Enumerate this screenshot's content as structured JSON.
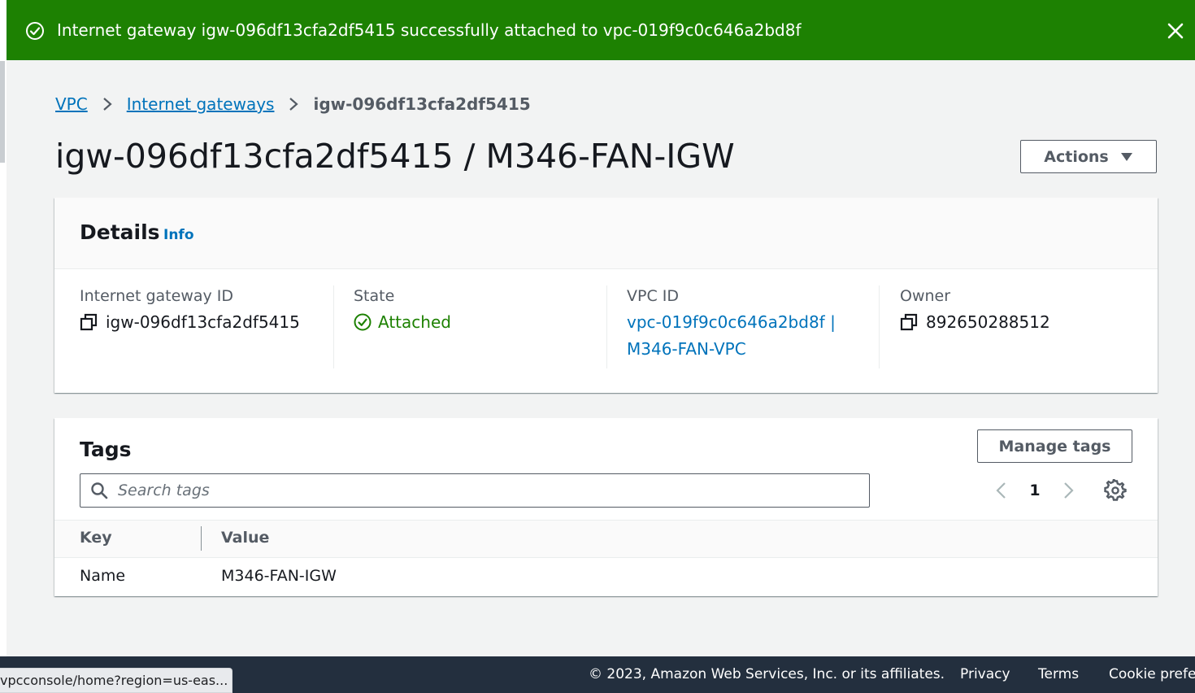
{
  "flash": {
    "message": "Internet gateway igw-096df13cfa2df5415 successfully attached to vpc-019f9c0c646a2bd8f",
    "color": "#1d8102"
  },
  "breadcrumb": {
    "items": [
      "VPC",
      "Internet gateways"
    ],
    "current": "igw-096df13cfa2df5415"
  },
  "page": {
    "title": "igw-096df13cfa2df5415 / M346-FAN-IGW",
    "actions_label": "Actions"
  },
  "details": {
    "heading": "Details",
    "info_label": "Info",
    "fields": {
      "gateway_id": {
        "label": "Internet gateway ID",
        "value": "igw-096df13cfa2df5415"
      },
      "state": {
        "label": "State",
        "value": "Attached"
      },
      "vpc_id": {
        "label": "VPC ID",
        "value_line1": "vpc-019f9c0c646a2bd8f |",
        "value_line2": "M346-FAN-VPC"
      },
      "owner": {
        "label": "Owner",
        "value": "892650288512"
      }
    }
  },
  "tags": {
    "heading": "Tags",
    "manage_label": "Manage tags",
    "search_placeholder": "Search tags",
    "page_number": "1",
    "columns": [
      "Key",
      "Value"
    ],
    "rows": [
      {
        "key": "Name",
        "value": "M346-FAN-IGW"
      }
    ]
  },
  "footer": {
    "copyright": "© 2023, Amazon Web Services, Inc. or its affiliates.",
    "privacy": "Privacy",
    "terms": "Terms",
    "cookie": "Cookie prefer"
  },
  "status_url": "vpcconsole/home?region=us-eas...",
  "colors": {
    "link": "#0073bb",
    "success": "#1d8102",
    "footer_bg": "#232f3e"
  }
}
